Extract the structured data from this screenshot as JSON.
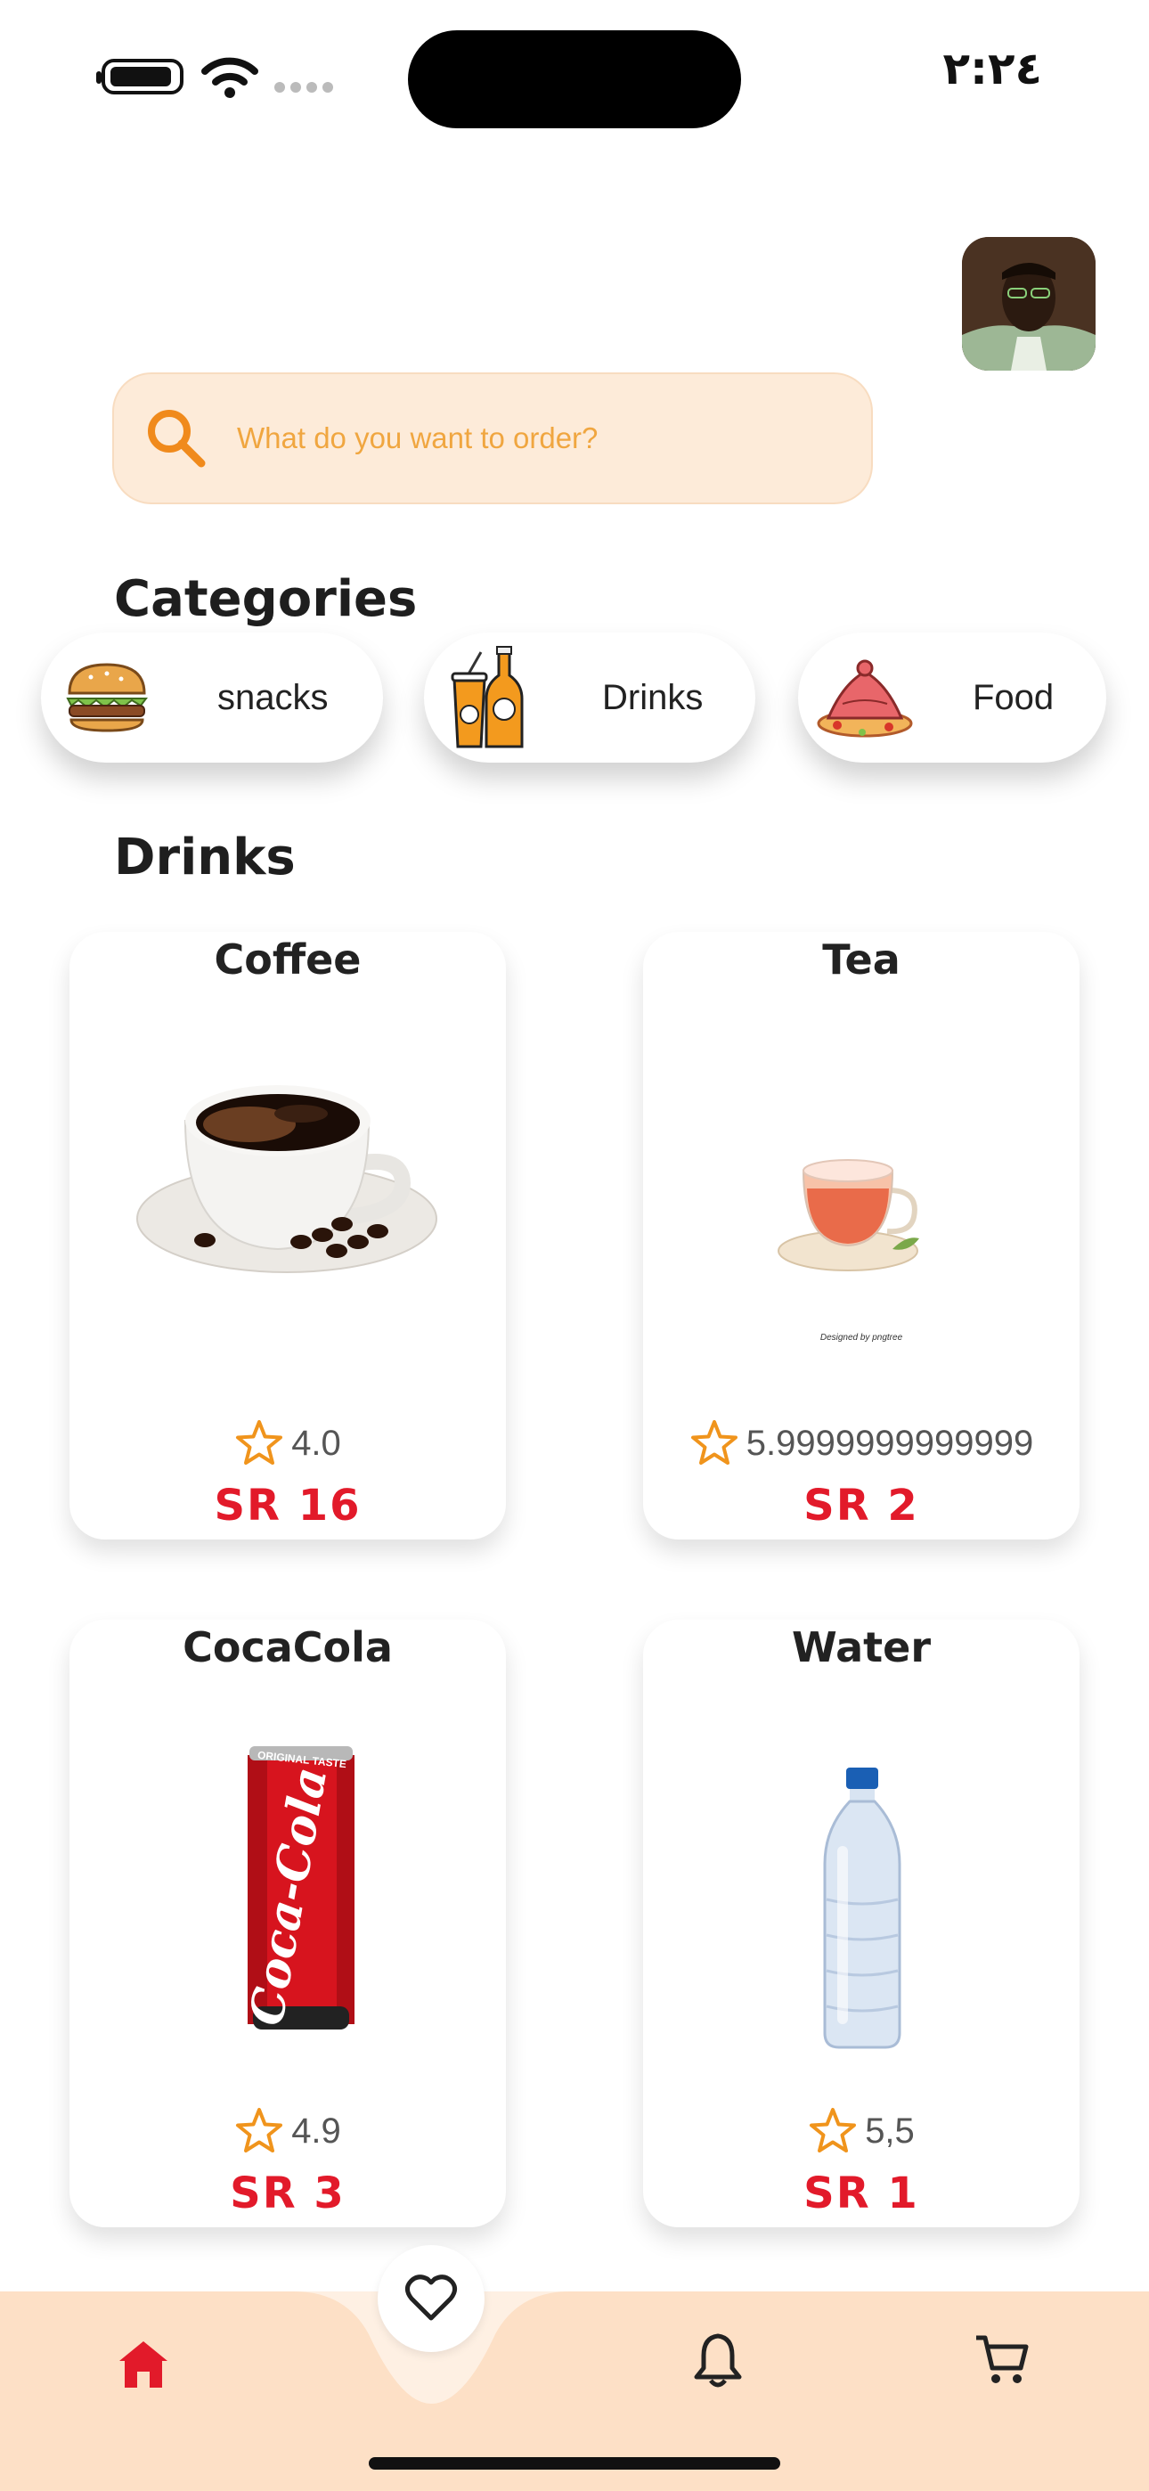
{
  "status_bar": {
    "time": "٢:٢٤"
  },
  "search": {
    "placeholder": "What do you want to order?"
  },
  "sections": {
    "categories_title": "Categories",
    "products_title": "Drinks"
  },
  "categories": [
    {
      "label": "snacks",
      "icon": "burger-icon"
    },
    {
      "label": "Drinks",
      "icon": "drinks-icon"
    },
    {
      "label": "Food",
      "icon": "tajine-icon"
    }
  ],
  "products": [
    {
      "name": "Coffee",
      "rating": "4.0",
      "price": "SR 16",
      "image": "coffee-cup-image"
    },
    {
      "name": "Tea",
      "rating": "5.9999999999999",
      "price": "SR 2",
      "image": "tea-cup-image",
      "watermark": "Designed by pngtree"
    },
    {
      "name": "CocaCola",
      "rating": "4.9",
      "price": "SR 3",
      "image": "cocacola-can-image",
      "can_text": "Coca-Cola",
      "can_top_text": "ORIGINAL TASTE"
    },
    {
      "name": "Water",
      "rating": "5,5",
      "price": "SR 1",
      "image": "water-bottle-image"
    }
  ],
  "nav": {
    "items": [
      {
        "name": "home",
        "icon": "home-icon",
        "active": true
      },
      {
        "name": "favorites",
        "icon": "heart-icon",
        "active": false
      },
      {
        "name": "notifications",
        "icon": "bell-icon",
        "active": false
      },
      {
        "name": "cart",
        "icon": "cart-icon",
        "active": false
      }
    ]
  },
  "colors": {
    "accent": "#e21a2a",
    "search_bg": "#fdebd9",
    "search_text": "#f0a640",
    "nav_bg": "#fde0c6"
  }
}
